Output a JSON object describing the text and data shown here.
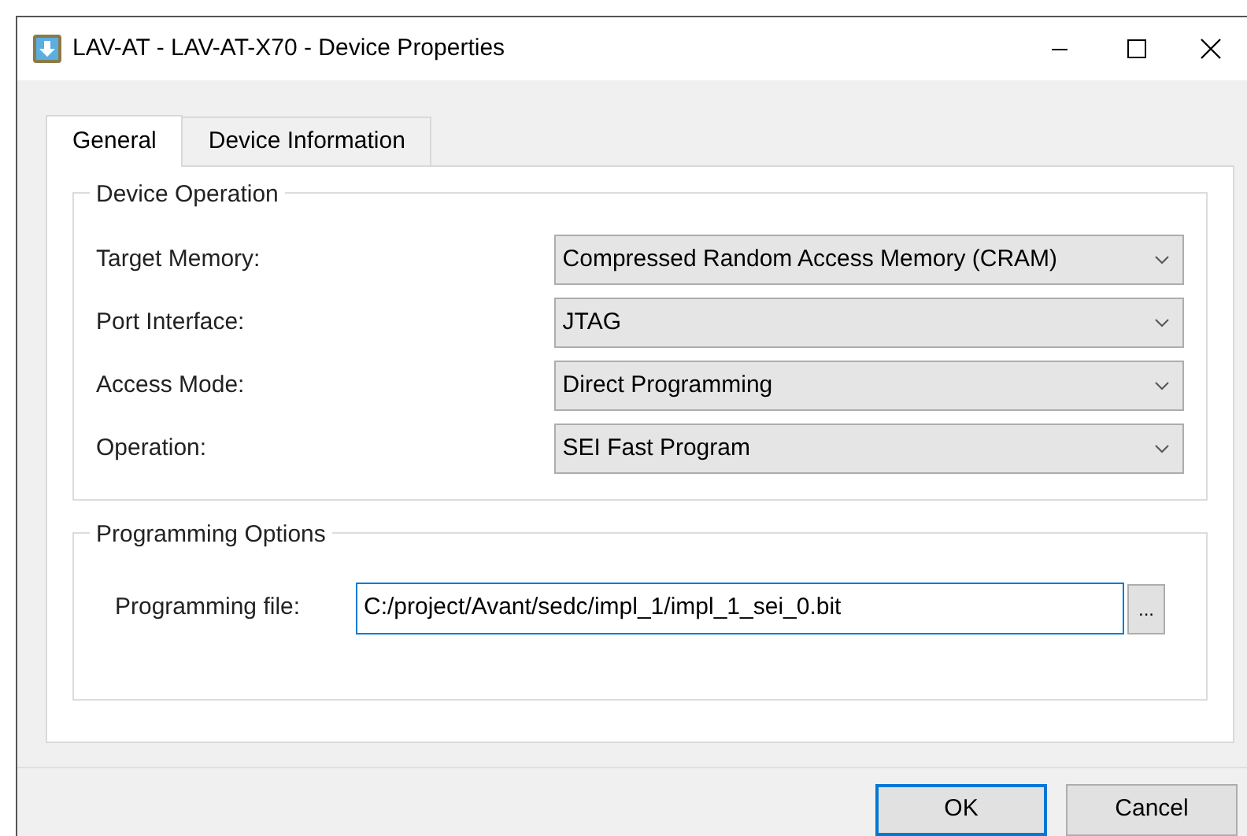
{
  "window": {
    "title": "LAV-AT - LAV-AT-X70 - Device Properties"
  },
  "tabs": [
    {
      "label": "General",
      "selected": true
    },
    {
      "label": "Device Information",
      "selected": false
    }
  ],
  "device_operation": {
    "title": "Device Operation",
    "fields": [
      {
        "label": "Target Memory:",
        "value": "Compressed Random Access Memory (CRAM)"
      },
      {
        "label": "Port Interface:",
        "value": "JTAG"
      },
      {
        "label": "Access Mode:",
        "value": "Direct Programming"
      },
      {
        "label": "Operation:",
        "value": "SEI Fast Program"
      }
    ]
  },
  "programming_options": {
    "title": "Programming Options",
    "file_label": "Programming file:",
    "file_value": "C:/project/Avant/sedc/impl_1/impl_1_sei_0.bit",
    "browse": "..."
  },
  "buttons": [
    {
      "label": "OK",
      "default": true
    },
    {
      "label": "Cancel",
      "default": false
    }
  ]
}
